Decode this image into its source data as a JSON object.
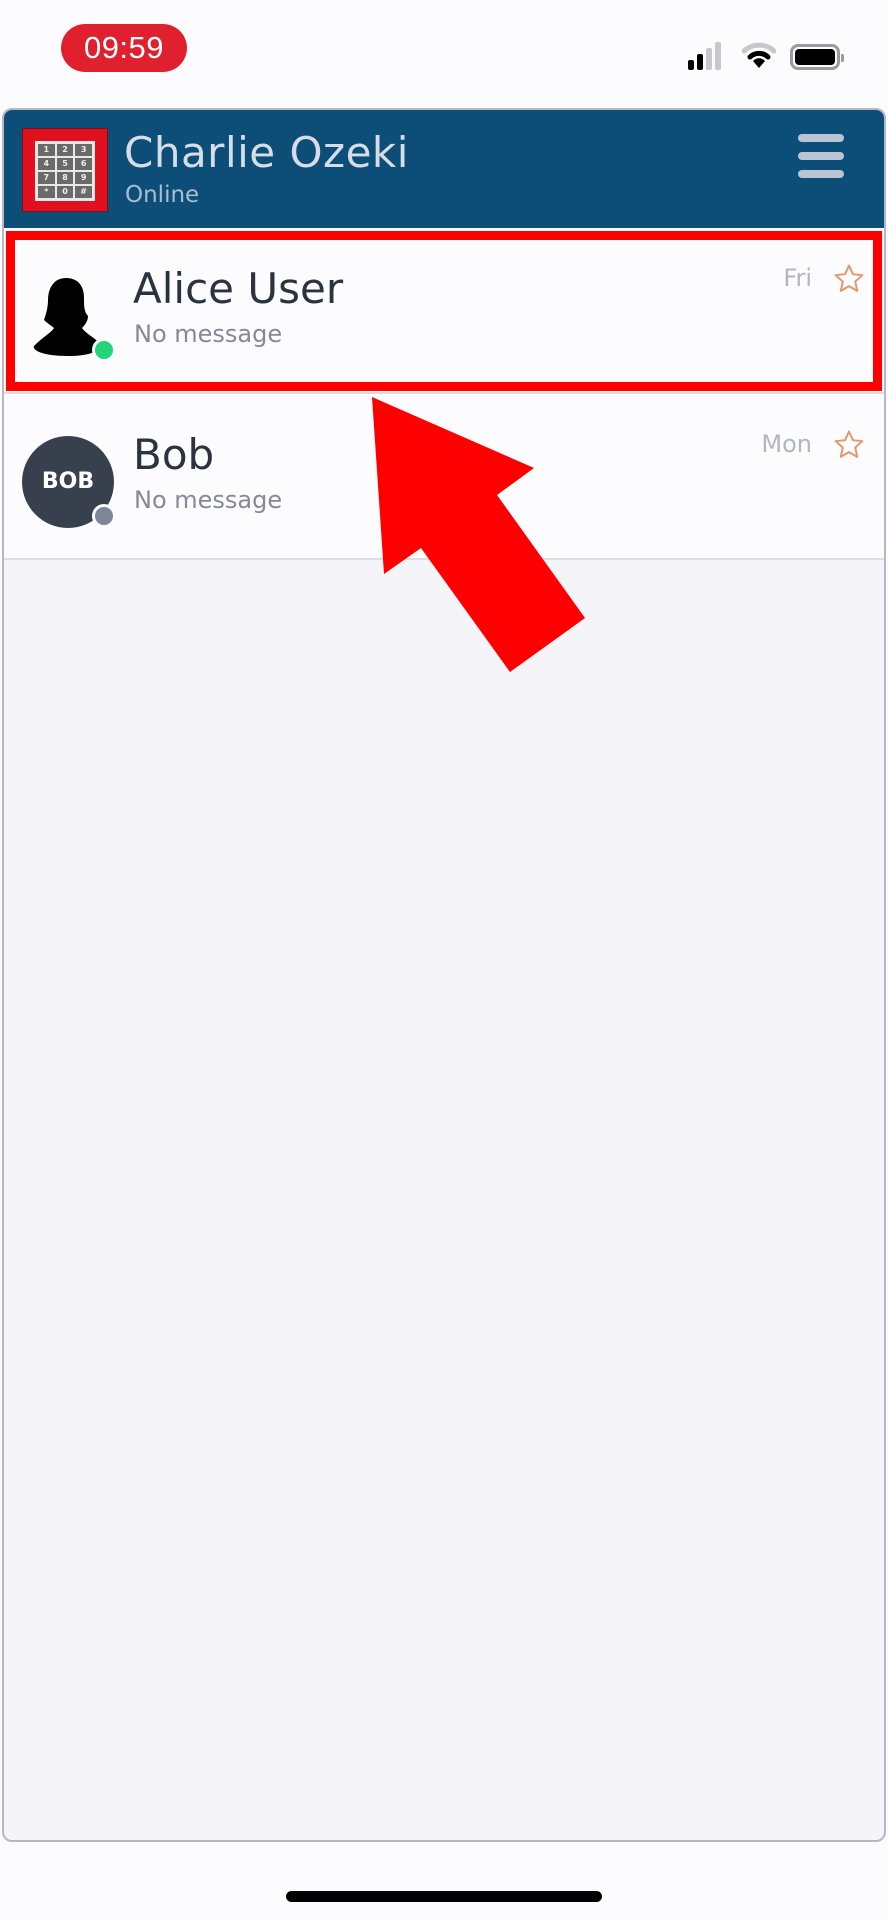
{
  "status_bar": {
    "time": "09:59",
    "signal_icon": "cellular-signal-icon",
    "wifi_icon": "wifi-icon",
    "battery_icon": "battery-icon"
  },
  "header": {
    "logo_icon": "keypad-logo-icon",
    "title": "Charlie Ozeki",
    "status": "Online",
    "menu_icon": "hamburger-menu-icon",
    "logo_keys": [
      "1",
      "2",
      "3",
      "4",
      "5",
      "6",
      "7",
      "8",
      "9",
      "*",
      "0",
      "#"
    ]
  },
  "contacts": [
    {
      "name": "Alice User",
      "last_message": "No message",
      "time": "Fri",
      "avatar": "silhouette",
      "presence": "online",
      "favorite": false
    },
    {
      "name": "Bob",
      "last_message": "No message",
      "time": "Mon",
      "avatar_initials": "BOB",
      "presence": "offline",
      "favorite": false
    }
  ],
  "colors": {
    "header_bg": "#0c4e78",
    "highlight": "#ff0000",
    "online": "#22d47a",
    "offline": "#7d8598",
    "star": "#e8956a",
    "time_pill": "#e0202e"
  },
  "annotation": {
    "highlight_target": "Alice User",
    "arrow_icon": "red-pointer-arrow-icon"
  }
}
